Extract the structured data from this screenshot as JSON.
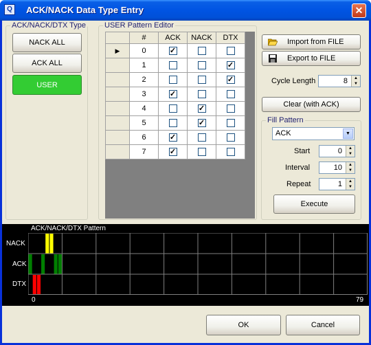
{
  "window": {
    "title": "ACK/NACK Data Type Entry",
    "close_glyph": "✕"
  },
  "type_group": {
    "label": "ACK/NACK/DTX Type",
    "buttons": [
      {
        "label": "NACK ALL",
        "active": false
      },
      {
        "label": "ACK ALL",
        "active": false
      },
      {
        "label": "USER",
        "active": true
      }
    ]
  },
  "editor": {
    "label": "USER Pattern Editor",
    "columns": [
      "#",
      "ACK",
      "NACK",
      "DTX"
    ],
    "current_row_marker": "▶",
    "rows": [
      {
        "n": "0",
        "ack": true,
        "nack": false,
        "dtx": false
      },
      {
        "n": "1",
        "ack": false,
        "nack": false,
        "dtx": true
      },
      {
        "n": "2",
        "ack": false,
        "nack": false,
        "dtx": true
      },
      {
        "n": "3",
        "ack": true,
        "nack": false,
        "dtx": false
      },
      {
        "n": "4",
        "ack": false,
        "nack": true,
        "dtx": false
      },
      {
        "n": "5",
        "ack": false,
        "nack": true,
        "dtx": false
      },
      {
        "n": "6",
        "ack": true,
        "nack": false,
        "dtx": false
      },
      {
        "n": "7",
        "ack": true,
        "nack": false,
        "dtx": false
      }
    ]
  },
  "file": {
    "import_label": "Import from FILE",
    "export_label": "Export to FILE",
    "import_icon": "folder-open-icon",
    "export_icon": "floppy-disk-icon"
  },
  "cycle": {
    "label": "Cycle Length",
    "value": "8"
  },
  "clear_label": "Clear (with ACK)",
  "fill": {
    "label": "Fill Pattern",
    "select_value": "ACK",
    "start_label": "Start",
    "start_value": "0",
    "interval_label": "Interval",
    "interval_value": "10",
    "repeat_label": "Repeat",
    "repeat_value": "1",
    "execute_label": "Execute"
  },
  "pattern_view": {
    "title": "ACK/NACK/DTX Pattern",
    "row_labels": [
      "NACK",
      "ACK",
      "DTX"
    ],
    "x_start_label": "0",
    "x_end_label": "79",
    "total_slots": 80,
    "colors": {
      "NACK": "#ffff00",
      "ACK": "#007f00",
      "DTX": "#ff0000",
      "grid": "#808080"
    },
    "slots": [
      "ACK",
      "DTX",
      "DTX",
      "ACK",
      "NACK",
      "NACK",
      "ACK",
      "ACK"
    ]
  },
  "footer": {
    "ok_label": "OK",
    "cancel_label": "Cancel"
  },
  "colors": {
    "active_button": "#33cc33",
    "title_bar": "#0054e3",
    "face": "#ece9d8"
  }
}
